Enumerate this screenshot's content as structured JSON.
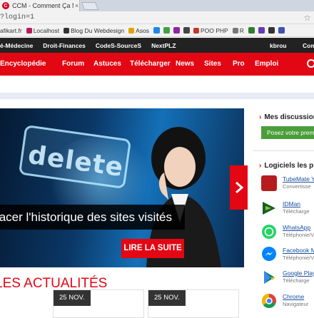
{
  "browser": {
    "tab_title": "CCM - Comment Ça Mar",
    "tab_close": "×",
    "favicon_letter": "C",
    "address": "?login=1",
    "star_icon": "star-icon"
  },
  "bookmarks": [
    {
      "label": "afikart.fr",
      "color": "#3b6fd8"
    },
    {
      "label": "Localhost",
      "color": "#c2185b"
    },
    {
      "label": "Blog Du Webdesign",
      "color": "#333333"
    },
    {
      "label": "Asos",
      "color": "#e0a400"
    },
    {
      "label": "POO PHP",
      "color": "#c0392b"
    },
    {
      "label": "R",
      "color": "#777777"
    }
  ],
  "site_topbar": {
    "items": [
      "é-Médecine",
      "Droit-Finances",
      "CodeS-SourceS",
      "NextPLZ"
    ],
    "user": "kbrou",
    "extra": "Com"
  },
  "nav": {
    "items": [
      "Encyclopédie",
      "Forum",
      "Astuces",
      "Télécharger",
      "News",
      "Sites",
      "Pro",
      "Emploi"
    ],
    "search_icon": "search-icon"
  },
  "hero": {
    "image_text": "delete",
    "caption": "facer l'historique des sites visités",
    "button": "LIRE LA SUITE",
    "next_icon": "chevron-right-icon"
  },
  "sidebar": {
    "discussions_title": "Mes discussion",
    "ask_button": "Posez votre prem",
    "software_title": "Logiciels les plu",
    "software": [
      {
        "name": "TubeMate Yo",
        "sub": "Convertisse",
        "icon": "tubemate-icon",
        "color": "#b71c1c"
      },
      {
        "name": "IDMan",
        "sub": "Télécharge",
        "icon": "idman-icon",
        "color": "#1b5e20"
      },
      {
        "name": "WhatsApp",
        "sub": "Téléphonie/V",
        "icon": "whatsapp-icon",
        "color": "#25d366"
      },
      {
        "name": "Facebook Me",
        "sub": "Téléphonie/V",
        "icon": "messenger-icon",
        "color": "#0084ff"
      },
      {
        "name": "Google Play",
        "sub": "Télécharge",
        "icon": "google-play-icon",
        "color": "#01875f"
      },
      {
        "name": "Chrome",
        "sub": "Navigateur",
        "icon": "chrome-icon",
        "color": "#db4437"
      }
    ]
  },
  "news": {
    "title": "LES ACTUALITÉS",
    "cards": [
      {
        "date": "25 NOV."
      },
      {
        "date": "25 NOV."
      }
    ]
  }
}
